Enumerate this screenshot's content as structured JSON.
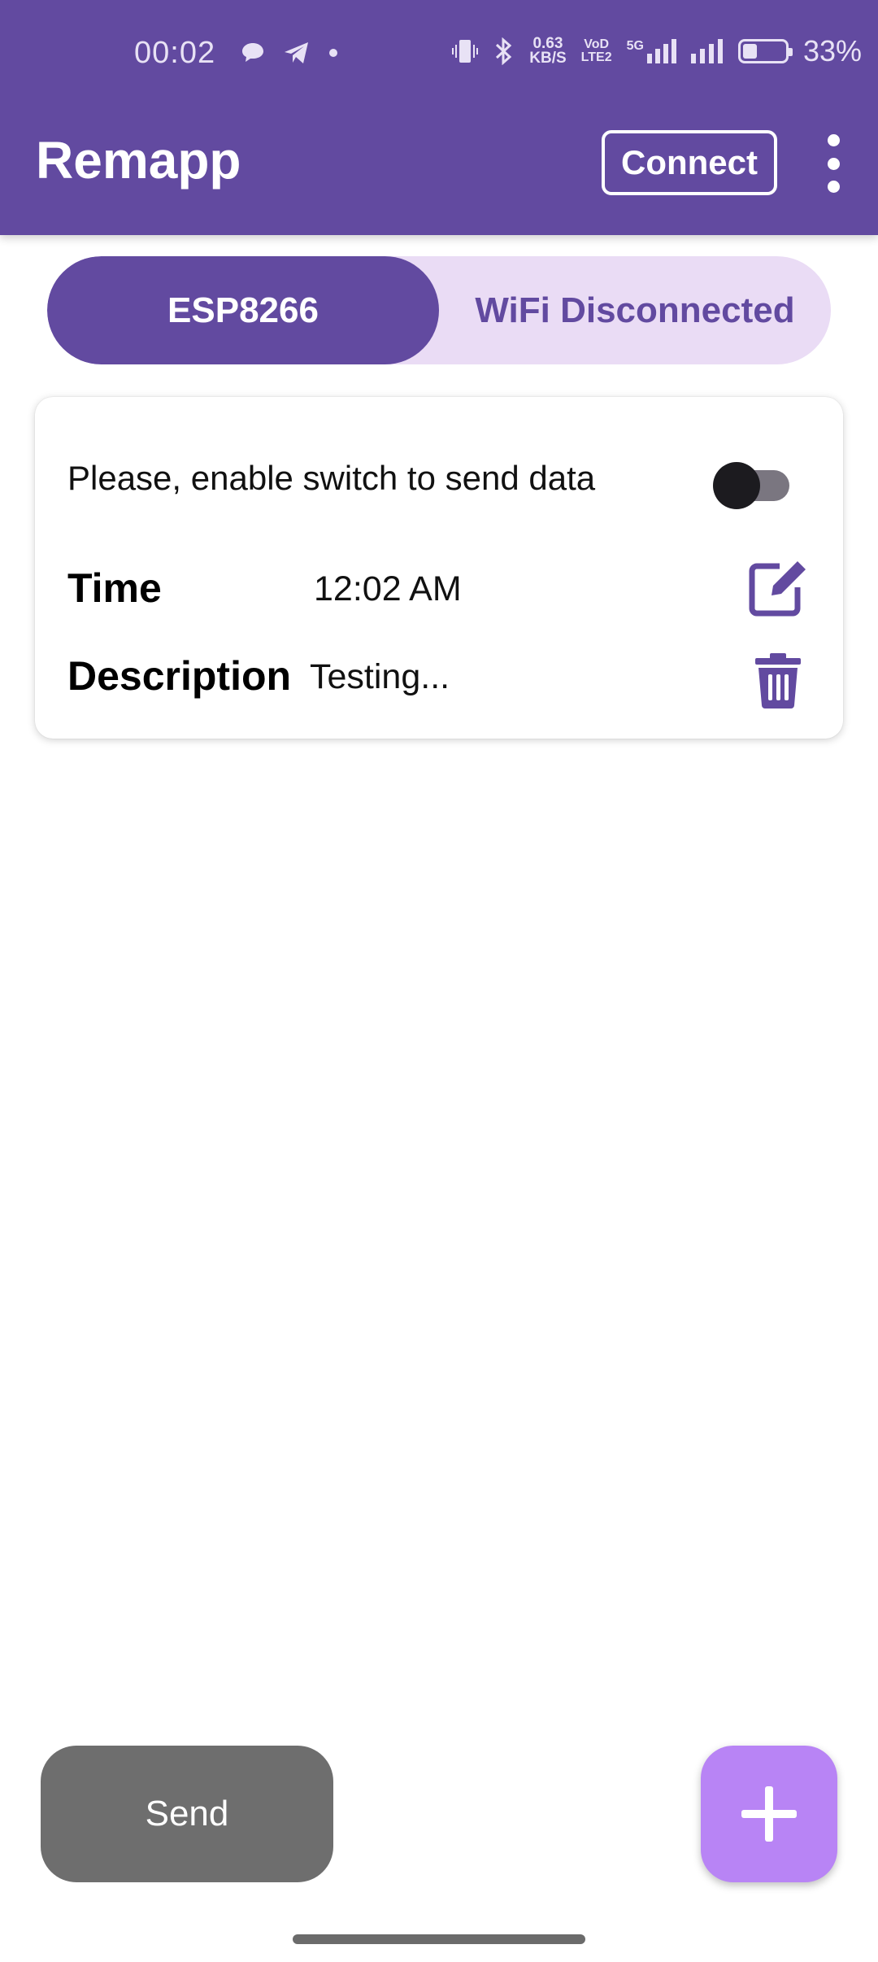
{
  "status_bar": {
    "time": "00:02",
    "net_speed_value": "0.63",
    "net_speed_unit": "KB/S",
    "volte_top": "VoD",
    "volte_bottom": "LTE2",
    "network": "5G",
    "battery": "33%"
  },
  "app_bar": {
    "title": "Remapp",
    "connect_label": "Connect"
  },
  "segment": {
    "left_label": "ESP8266",
    "right_label": "WiFi Disconnected"
  },
  "card": {
    "hint": "Please, enable switch to send data",
    "switch_on": false,
    "time_label": "Time",
    "time_value": "12:02 AM",
    "description_label": "Description",
    "description_value": "Testing..."
  },
  "actions": {
    "send_label": "Send"
  },
  "colors": {
    "primary": "#624aa0",
    "segment_bg": "#eadcf5",
    "fab": "#b884f5",
    "send_button": "#6e6e6e"
  },
  "icons": {
    "edit": "edit-icon",
    "delete": "trash-icon",
    "add": "plus-icon",
    "menu": "more-vert-icon"
  }
}
